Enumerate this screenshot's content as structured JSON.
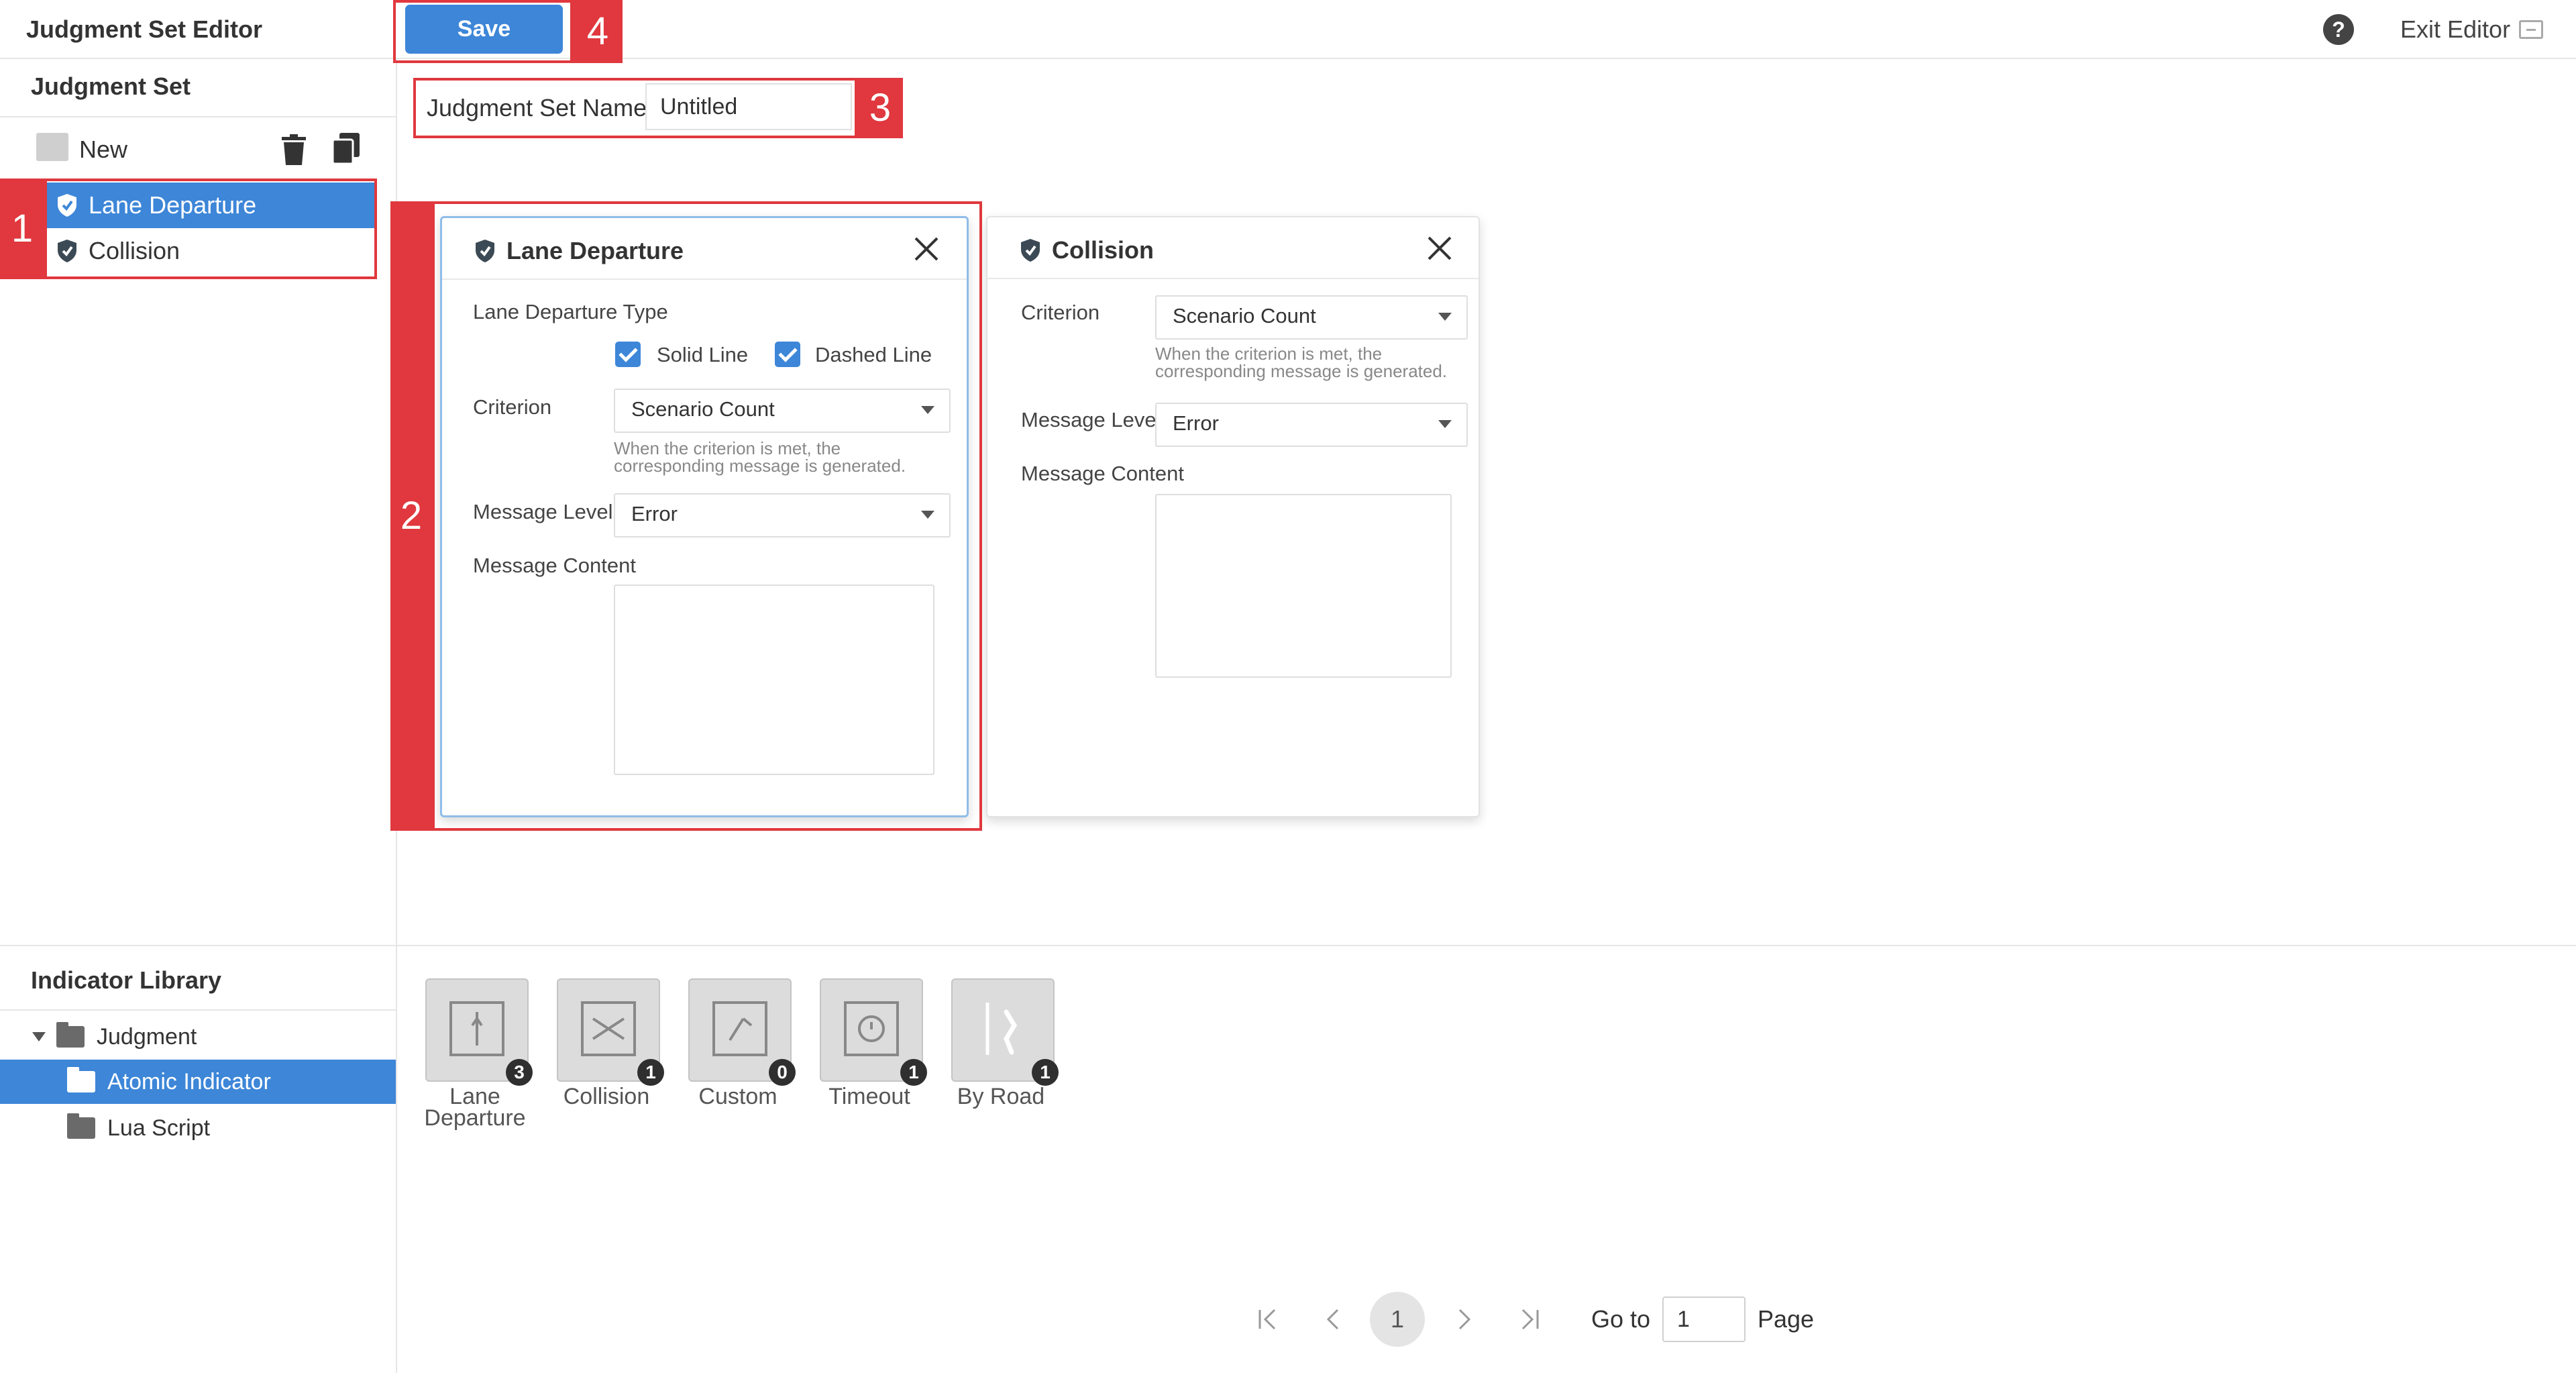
{
  "header": {
    "title": "Judgment Set Editor",
    "save_label": "Save",
    "help_glyph": "?",
    "exit_label": "Exit Editor",
    "accent_color": "#3d86d8"
  },
  "sidebar": {
    "title": "Judgment Set",
    "new_label": "New",
    "items": [
      {
        "label": "Lane Departure",
        "selected": true,
        "icon": "shield-icon"
      },
      {
        "label": "Collision",
        "selected": false,
        "icon": "shield-icon"
      }
    ]
  },
  "name_field": {
    "label": "Judgment Set Name",
    "value": "Untitled"
  },
  "cards": {
    "lane": {
      "title": "Lane Departure",
      "type_label": "Lane Departure Type",
      "options": [
        {
          "label": "Solid Line",
          "checked": true
        },
        {
          "label": "Dashed Line",
          "checked": true
        }
      ],
      "criterion_label": "Criterion",
      "criterion_value": "Scenario Count",
      "hint_line1": "When the criterion is met, the",
      "hint_line2": "corresponding message is generated.",
      "level_label": "Message Level",
      "level_value": "Error",
      "content_label": "Message Content"
    },
    "collision": {
      "title": "Collision",
      "criterion_label": "Criterion",
      "criterion_value": "Scenario Count",
      "hint_line1": "When the criterion is met, the",
      "hint_line2": "corresponding message is generated.",
      "level_label": "Message Level",
      "level_value": "Error",
      "content_label": "Message Content"
    }
  },
  "annotations": [
    "1",
    "2",
    "3",
    "4"
  ],
  "annotation_color": "#e0383e",
  "library": {
    "title": "Indicator Library",
    "tree": [
      {
        "label": "Judgment",
        "expanded": true
      },
      {
        "label": "Atomic Indicator",
        "selected": true
      },
      {
        "label": "Lua Script"
      }
    ],
    "indicators": [
      {
        "line1": "Lane",
        "line2": "Departure",
        "count": "3",
        "icon": "lane-departure-icon"
      },
      {
        "line1": "Collision",
        "line2": "",
        "count": "1",
        "icon": "collision-icon"
      },
      {
        "line1": "Custom",
        "line2": "",
        "count": "0",
        "icon": "custom-icon"
      },
      {
        "line1": "Timeout",
        "line2": "",
        "count": "1",
        "icon": "timeout-icon"
      },
      {
        "line1": "By Road",
        "line2": "",
        "count": "1",
        "icon": "by-road-icon"
      }
    ]
  },
  "pagination": {
    "current": "1",
    "goto_label": "Go to",
    "goto_value": "1",
    "page_label": "Page"
  }
}
